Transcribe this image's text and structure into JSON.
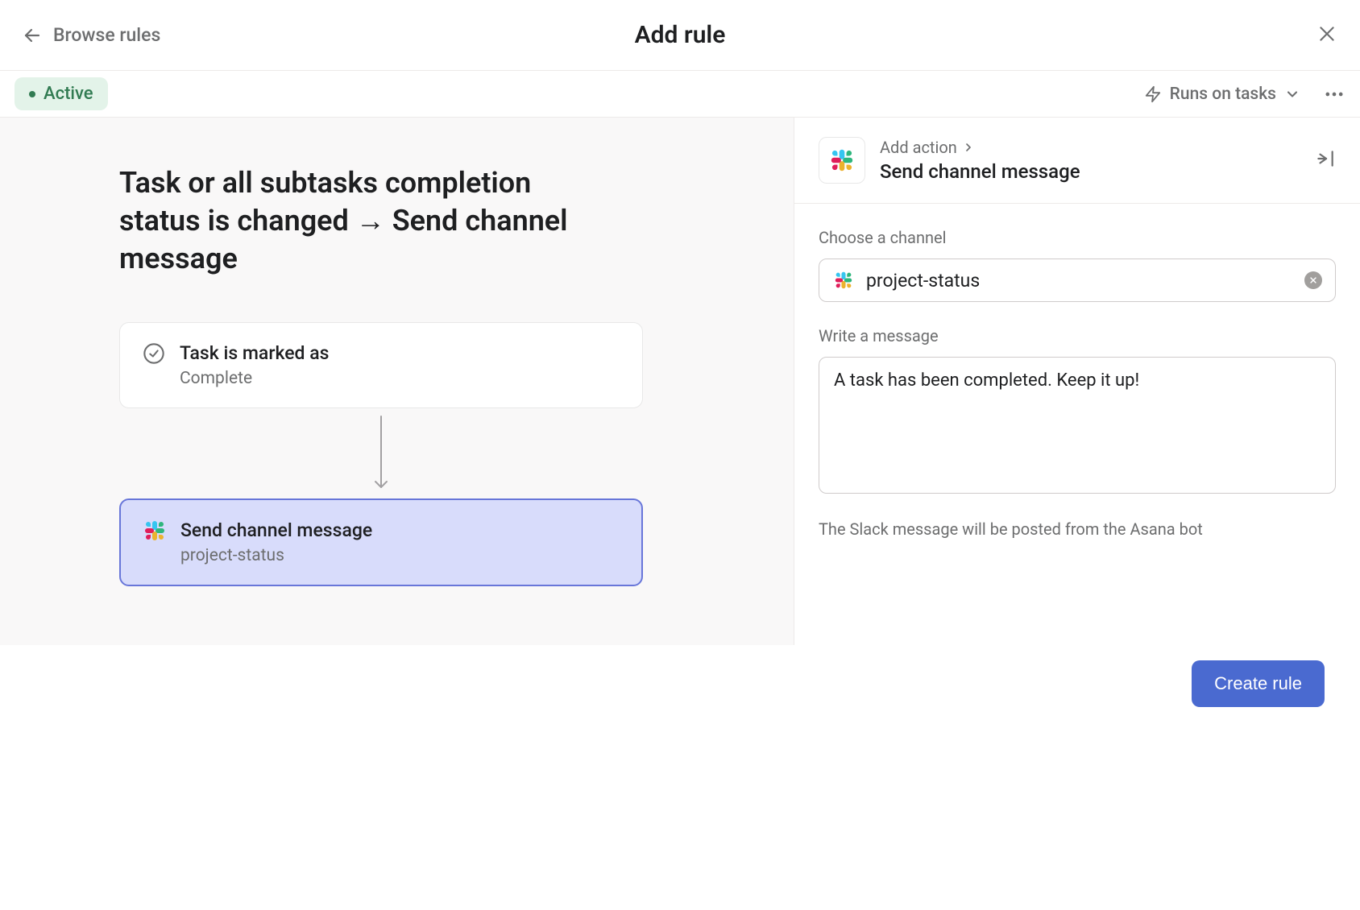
{
  "header": {
    "back_label": "Browse rules",
    "title": "Add rule"
  },
  "toolbar": {
    "status": "Active",
    "runs_on_label": "Runs on tasks"
  },
  "rule_summary": "Task or all subtasks completion status is changed → Send channel message",
  "trigger_card": {
    "title": "Task is marked as",
    "subtitle": "Complete"
  },
  "action_card": {
    "title": "Send channel message",
    "subtitle": "project-status"
  },
  "panel": {
    "breadcrumb": "Add action",
    "title": "Send channel message",
    "channel_label": "Choose a channel",
    "channel_value": "project-status",
    "message_label": "Write a message",
    "message_value": "A task has been completed. Keep it up!",
    "helper": "The Slack message will be posted from the Asana bot"
  },
  "footer": {
    "create_label": "Create rule"
  }
}
